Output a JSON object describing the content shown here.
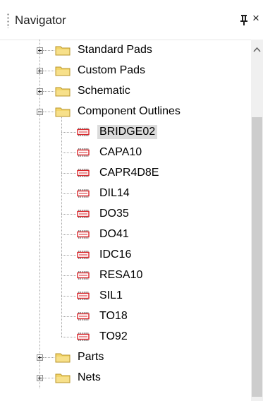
{
  "panel": {
    "title": "Navigator",
    "pin_label": "pin-icon",
    "close_label": "×"
  },
  "tree": {
    "top_folders": [
      {
        "label": "Standard Pads",
        "expanded": false
      },
      {
        "label": "Custom Pads",
        "expanded": false
      },
      {
        "label": "Schematic",
        "expanded": false
      },
      {
        "label": "Component Outlines",
        "expanded": true
      }
    ],
    "components": [
      {
        "label": "BRIDGE02",
        "selected": true
      },
      {
        "label": "CAPA10"
      },
      {
        "label": "CAPR4D8E"
      },
      {
        "label": "DIL14"
      },
      {
        "label": "DO35"
      },
      {
        "label": "DO41"
      },
      {
        "label": "IDC16"
      },
      {
        "label": "RESA10"
      },
      {
        "label": "SIL1"
      },
      {
        "label": "TO18"
      },
      {
        "label": "TO92"
      }
    ],
    "bottom_folders": [
      {
        "label": "Parts",
        "expanded": false
      },
      {
        "label": "Nets",
        "expanded": false
      }
    ]
  },
  "icons": {
    "folder_color": "#f2d56b",
    "component_color": "#d9262b"
  }
}
